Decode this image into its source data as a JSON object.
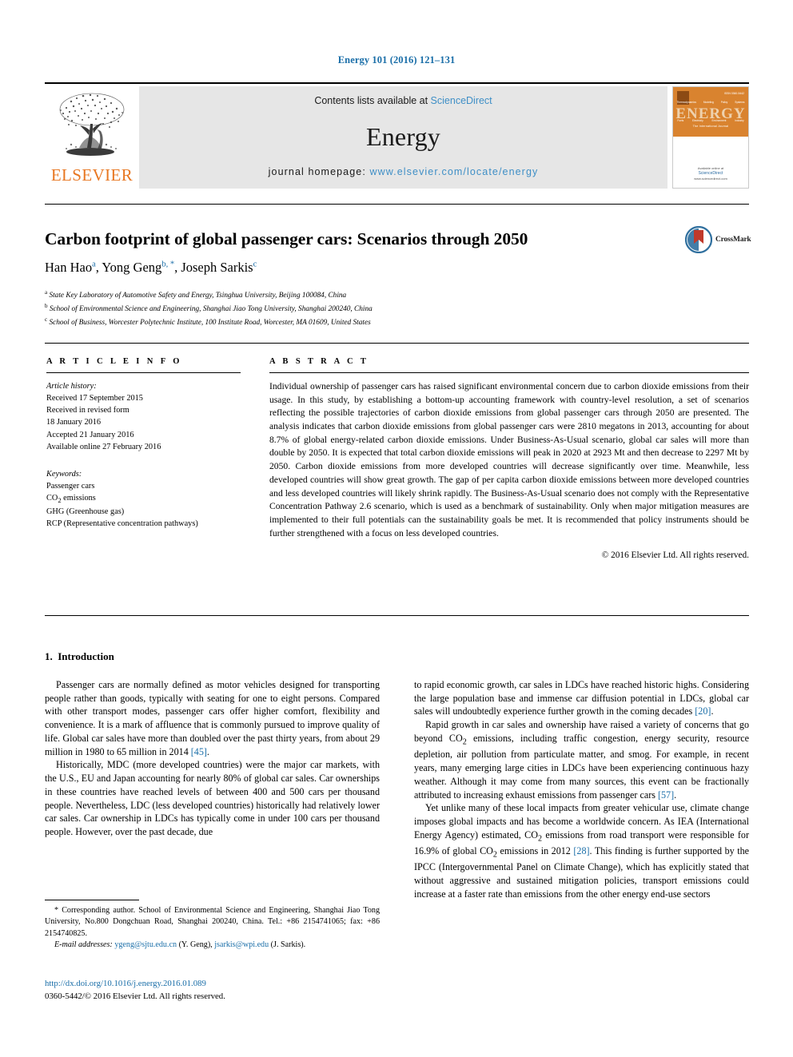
{
  "running_head": "Energy 101 (2016) 121–131",
  "masthead": {
    "publisher_name": "ELSEVIER",
    "contents_prefix": "Contents lists available at ",
    "contents_link": "ScienceDirect",
    "journal_title": "Energy",
    "homepage_prefix": "journal homepage: ",
    "homepage_url": "www.elsevier.com/locate/energy",
    "cover": {
      "title": "ENERGY",
      "issue_label": "ISSN 0360-5442",
      "tagline": "The International Journal",
      "section_labels_top": [
        "Thermodynamics",
        "Modeling",
        "Policy",
        "Systems"
      ],
      "section_labels_bottom": [
        "Fuels",
        "Electricity",
        "Environment",
        "Industry"
      ],
      "footer_available": "Available online at",
      "footer_brand": "ScienceDirect",
      "footer_sub": "www.sciencedirect.com"
    }
  },
  "title": "Carbon footprint of global passenger cars: Scenarios through 2050",
  "crossmark_label": "CrossMark",
  "authors": [
    {
      "name": "Han Hao",
      "marks": "a",
      "sep": ", "
    },
    {
      "name": "Yong Geng",
      "marks": "b, *",
      "sep": ", "
    },
    {
      "name": "Joseph Sarkis",
      "marks": "c",
      "sep": ""
    }
  ],
  "affiliations": [
    {
      "mark": "a",
      "text": "State Key Laboratory of Automotive Safety and Energy, Tsinghua University, Beijing 100084, China"
    },
    {
      "mark": "b",
      "text": "School of Environmental Science and Engineering, Shanghai Jiao Tong University, Shanghai 200240, China"
    },
    {
      "mark": "c",
      "text": "School of Business, Worcester Polytechnic Institute, 100 Institute Road, Worcester, MA 01609, United States"
    }
  ],
  "article_info": {
    "heading": "A R T I C L E  I N F O",
    "history_label": "Article history:",
    "history": [
      "Received 17 September 2015",
      "Received in revised form",
      "18 January 2016",
      "Accepted 21 January 2016",
      "Available online 27 February 2016"
    ],
    "keywords_label": "Keywords:",
    "keywords": [
      "Passenger cars",
      "CO2 emissions",
      "GHG (Greenhouse gas)",
      "RCP (Representative concentration pathways)"
    ]
  },
  "abstract": {
    "heading": "A B S T R A C T",
    "text": "Individual ownership of passenger cars has raised significant environmental concern due to carbon dioxide emissions from their usage. In this study, by establishing a bottom-up accounting framework with country-level resolution, a set of scenarios reflecting the possible trajectories of carbon dioxide emissions from global passenger cars through 2050 are presented. The analysis indicates that carbon dioxide emissions from global passenger cars were 2810 megatons in 2013, accounting for about 8.7% of global energy-related carbon dioxide emissions. Under Business-As-Usual scenario, global car sales will more than double by 2050. It is expected that total carbon dioxide emissions will peak in 2020 at 2923 Mt and then decrease to 2297 Mt by 2050. Carbon dioxide emissions from more developed countries will decrease significantly over time. Meanwhile, less developed countries will show great growth. The gap of per capita carbon dioxide emissions between more developed countries and less developed countries will likely shrink rapidly. The Business-As-Usual scenario does not comply with the Representative Concentration Pathway 2.6 scenario, which is used as a benchmark of sustainability. Only when major mitigation measures are implemented to their full potentials can the sustainability goals be met. It is recommended that policy instruments should be further strengthened with a focus on less developed countries.",
    "copyright": "© 2016 Elsevier Ltd. All rights reserved."
  },
  "section": {
    "number": "1.",
    "title": "Introduction"
  },
  "body": {
    "left_paragraphs": [
      "Passenger cars are normally defined as motor vehicles designed for transporting people rather than goods, typically with seating for one to eight persons. Compared with other transport modes, passenger cars offer higher comfort, flexibility and convenience. It is a mark of affluence that is commonly pursued to improve quality of life. Global car sales have more than doubled over the past thirty years, from about 29 million in 1980 to 65 million in 2014 [45].",
      "Historically, MDC (more developed countries) were the major car markets, with the U.S., EU and Japan accounting for nearly 80% of global car sales. Car ownerships in these countries have reached levels of between 400 and 500 cars per thousand people. Nevertheless, LDC (less developed countries) historically had relatively lower car sales. Car ownership in LDCs has typically come in under 100 cars per thousand people. However, over the past decade, due"
    ],
    "right_paragraphs": [
      "to rapid economic growth, car sales in LDCs have reached historic highs. Considering the large population base and immense car diffusion potential in LDCs, global car sales will undoubtedly experience further growth in the coming decades [20].",
      "Rapid growth in car sales and ownership have raised a variety of concerns that go beyond CO2 emissions, including traffic congestion, energy security, resource depletion, air pollution from particulate matter, and smog. For example, in recent years, many emerging large cities in LDCs have been experiencing continuous hazy weather. Although it may come from many sources, this event can be fractionally attributed to increasing exhaust emissions from passenger cars [57].",
      "Yet unlike many of these local impacts from greater vehicular use, climate change imposes global impacts and has become a worldwide concern. As IEA (International Energy Agency) estimated, CO2 emissions from road transport were responsible for 16.9% of global CO2 emissions in 2012 [28]. This finding is further supported by the IPCC (Intergovernmental Panel on Climate Change), which has explicitly stated that without aggressive and sustained mitigation policies, transport emissions could increase at a faster rate than emissions from the other energy end-use sectors"
    ],
    "left_refs": [
      "[45]"
    ],
    "right_refs": [
      "[20]",
      "[57]",
      "[28]"
    ]
  },
  "footnote": {
    "corresponding": "* Corresponding author. School of Environmental Science and Engineering, Shanghai Jiao Tong University, No.800 Dongchuan Road, Shanghai 200240, China. Tel.: +86 2154741065; fax: +86 2154740825.",
    "email_label": "E-mail addresses:",
    "email1": "ygeng@sjtu.edu.cn",
    "email1_owner": "(Y. Geng),",
    "email2": "jsarkis@wpi.edu",
    "email2_owner": "(J. Sarkis)."
  },
  "doi": {
    "url": "http://dx.doi.org/10.1016/j.energy.2016.01.089",
    "issn_line": "0360-5442/© 2016 Elsevier Ltd. All rights reserved."
  },
  "colors": {
    "link_blue": "#1a6ea8",
    "sciencedirect_blue": "#3f8fc6",
    "elsevier_orange": "#e87722",
    "band_grey": "#e6e6e6"
  }
}
